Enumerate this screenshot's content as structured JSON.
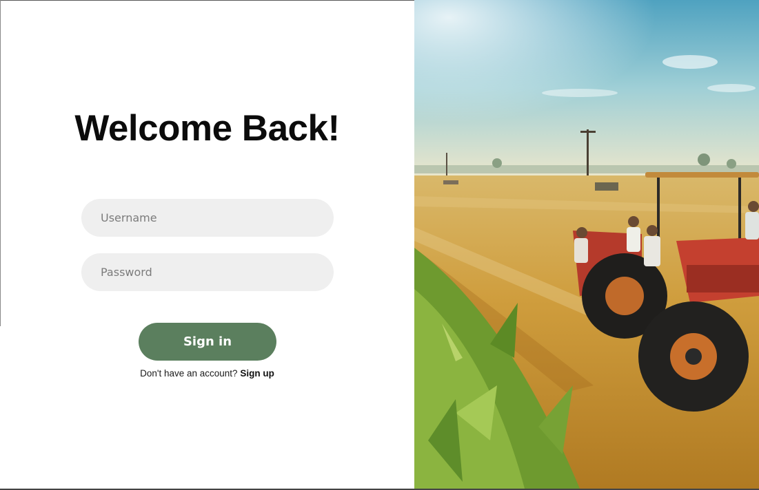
{
  "login": {
    "title": "Welcome Back!",
    "username": {
      "placeholder": "Username",
      "value": ""
    },
    "password": {
      "placeholder": "Password",
      "value": ""
    },
    "signin_label": "Sign in",
    "signup_prompt": "Don't have an account?",
    "signup_link": "Sign up"
  },
  "hero_image": {
    "subject": "farm-field-with-tractor-photo"
  },
  "colors": {
    "primary_button": "#5b7f5e",
    "input_background": "#efefef",
    "title_text": "#0b0b0b"
  }
}
